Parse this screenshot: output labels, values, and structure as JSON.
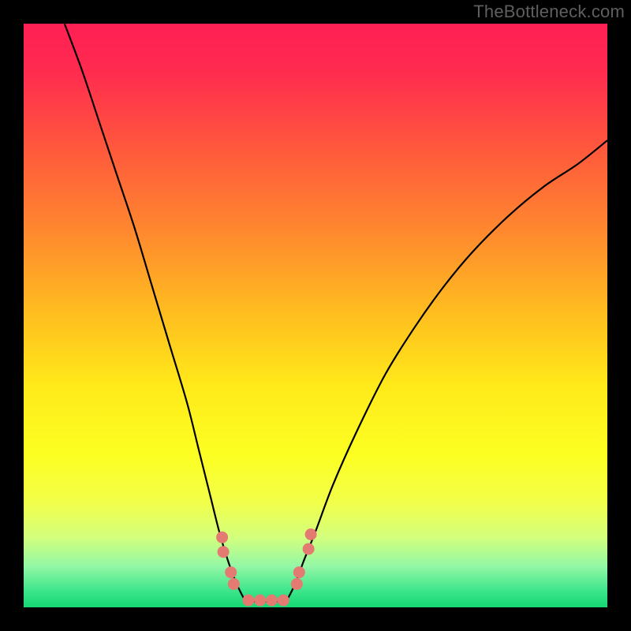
{
  "watermark": "TheBottleneck.com",
  "chart_data": {
    "type": "line",
    "title": "",
    "xlabel": "",
    "ylabel": "",
    "xlim": [
      0,
      100
    ],
    "ylim": [
      0,
      100
    ],
    "series": [
      {
        "name": "curve-left",
        "x": [
          7,
          10,
          13,
          16,
          19,
          22,
          25,
          28,
          30,
          32,
          33.5,
          35,
          36.5,
          38
        ],
        "y": [
          100,
          92,
          83,
          74,
          65,
          55,
          45,
          35,
          27,
          19,
          13,
          8,
          4,
          1
        ]
      },
      {
        "name": "curve-right",
        "x": [
          45,
          46.5,
          48,
          50,
          53,
          57,
          62,
          67,
          72,
          77,
          83,
          89,
          95,
          100
        ],
        "y": [
          1,
          4,
          8,
          13,
          21,
          30,
          40,
          48,
          55,
          61,
          67,
          72,
          76,
          80
        ]
      },
      {
        "name": "flat-bottom",
        "x": [
          38,
          45
        ],
        "y": [
          1,
          1
        ]
      }
    ],
    "markers": {
      "name": "highlight-dots",
      "color": "#e37b72",
      "points": [
        {
          "x": 34.0,
          "y": 12.0
        },
        {
          "x": 34.2,
          "y": 9.5
        },
        {
          "x": 35.5,
          "y": 6.0
        },
        {
          "x": 36.0,
          "y": 4.0
        },
        {
          "x": 38.5,
          "y": 1.2
        },
        {
          "x": 40.5,
          "y": 1.2
        },
        {
          "x": 42.5,
          "y": 1.2
        },
        {
          "x": 44.5,
          "y": 1.2
        },
        {
          "x": 46.8,
          "y": 4.0
        },
        {
          "x": 47.2,
          "y": 6.0
        },
        {
          "x": 48.8,
          "y": 10.0
        },
        {
          "x": 49.2,
          "y": 12.5
        }
      ]
    },
    "background_gradient": [
      {
        "pos": 0.0,
        "color": "#ff1f54"
      },
      {
        "pos": 0.08,
        "color": "#ff2b4f"
      },
      {
        "pos": 0.22,
        "color": "#ff5a3c"
      },
      {
        "pos": 0.36,
        "color": "#ff8a2e"
      },
      {
        "pos": 0.5,
        "color": "#ffbf1f"
      },
      {
        "pos": 0.62,
        "color": "#ffe91a"
      },
      {
        "pos": 0.74,
        "color": "#fcff22"
      },
      {
        "pos": 0.82,
        "color": "#f2ff4a"
      },
      {
        "pos": 0.88,
        "color": "#d3ff7d"
      },
      {
        "pos": 0.93,
        "color": "#93f7a6"
      },
      {
        "pos": 0.97,
        "color": "#3fe68b"
      },
      {
        "pos": 1.0,
        "color": "#14d875"
      }
    ]
  }
}
